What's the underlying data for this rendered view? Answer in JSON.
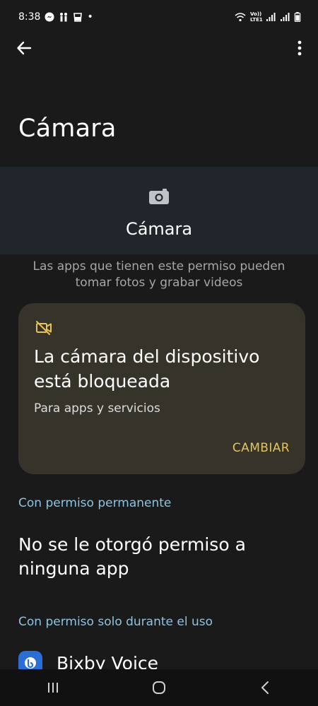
{
  "status_bar": {
    "time": "8:38",
    "dot": "•",
    "network_label": "Vo)) LTE1"
  },
  "page": {
    "title": "Cámara"
  },
  "header": {
    "title": "Cámara",
    "description": "Las apps que tienen este permiso pueden tomar fotos y grabar videos"
  },
  "blocked_card": {
    "title": "La cámara del dispositivo está bloqueada",
    "subtitle": "Para apps y servicios",
    "action_label": "CAMBIAR"
  },
  "sections": {
    "permanent_label": "Con permiso permanente",
    "permanent_empty": "No se le otorgó permiso a ninguna app",
    "while_using_label": "Con permiso solo durante el uso"
  },
  "apps": [
    {
      "name": "Bixby Voice",
      "icon": "bixby-icon"
    }
  ],
  "colors": {
    "background": "#1a1a1a",
    "header_band": "#20262b",
    "card": "#36342a",
    "accent_yellow": "#e6c35a",
    "section_blue": "#8fc3de"
  },
  "icons": {
    "back": "arrow-left-icon",
    "more": "more-vert-icon",
    "camera": "camera-icon",
    "camera_blocked": "video-off-icon"
  }
}
